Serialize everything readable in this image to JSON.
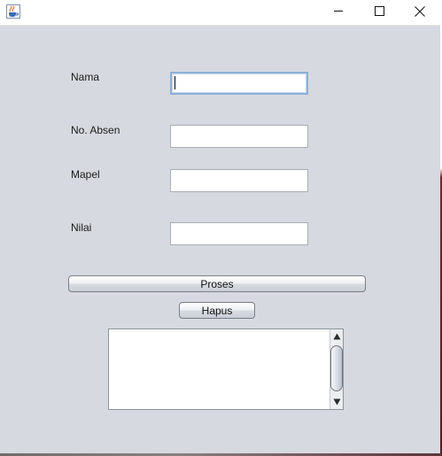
{
  "window": {
    "icons": {
      "app": "java-cup-icon",
      "minimize": "minimize-icon",
      "maximize": "maximize-icon",
      "close": "close-icon"
    }
  },
  "form": {
    "fields": [
      {
        "label": "Nama",
        "value": "",
        "focused": true
      },
      {
        "label": "No. Absen",
        "value": ""
      },
      {
        "label": "Mapel",
        "value": ""
      },
      {
        "label": "Nilai",
        "value": ""
      }
    ],
    "buttons": {
      "proses": "Proses",
      "hapus": "Hapus"
    },
    "output_area": {
      "value": ""
    }
  },
  "colors": {
    "panel_background": "#d6d9df",
    "focus_border": "#8fb0d4",
    "field_border": "#a9aeb5"
  }
}
